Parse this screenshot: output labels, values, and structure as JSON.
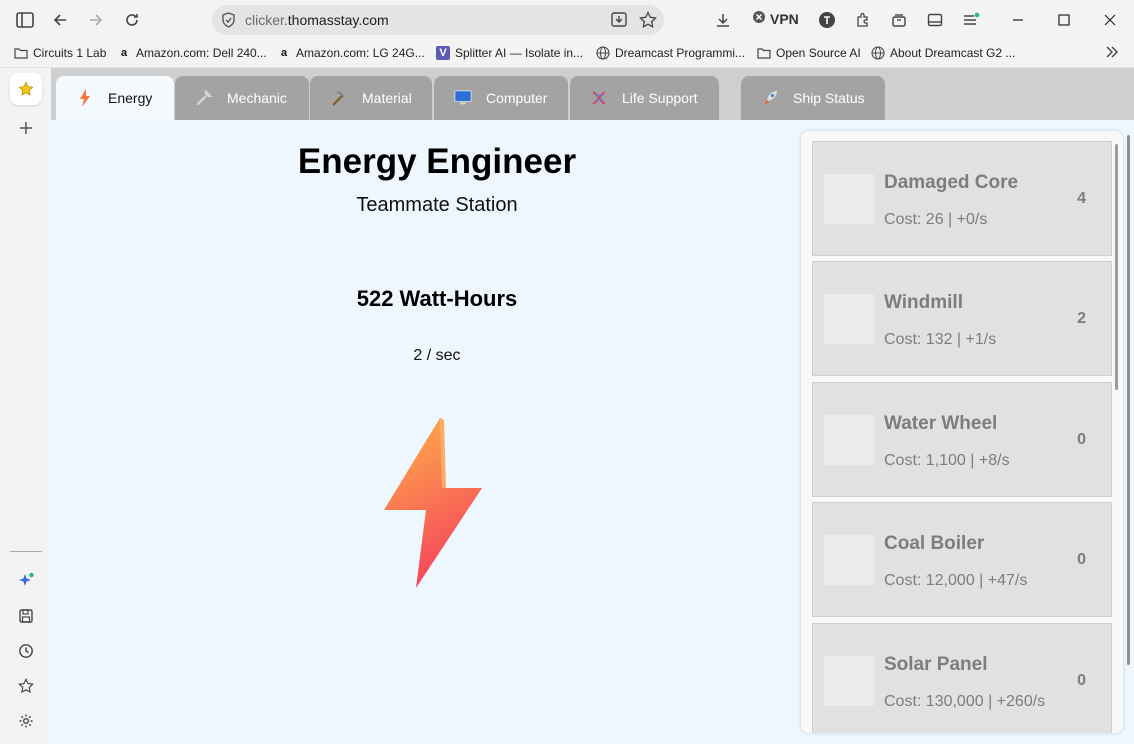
{
  "browser": {
    "url_host_prefix": "clicker.",
    "url_host_main": "thomasstay.com",
    "vpn_label": "VPN",
    "bookmarks": [
      {
        "label": "Circuits 1 Lab",
        "icon": "folder-icon"
      },
      {
        "label": "Amazon.com: Dell 240...",
        "icon": "amazon-icon"
      },
      {
        "label": "Amazon.com: LG 24G...",
        "icon": "amazon-icon"
      },
      {
        "label": "Splitter AI — Isolate in...",
        "icon": "splitter-icon"
      },
      {
        "label": "Dreamcast Programmi...",
        "icon": "globe-icon"
      },
      {
        "label": "Open Source AI",
        "icon": "folder-icon"
      },
      {
        "label": "About Dreamcast G2 ...",
        "icon": "globe-icon"
      }
    ]
  },
  "tabs": [
    {
      "label": "Energy",
      "icon": "lightning-icon",
      "active": true
    },
    {
      "label": "Mechanic",
      "icon": "wrench-icon",
      "active": false
    },
    {
      "label": "Material",
      "icon": "pickaxe-icon",
      "active": false
    },
    {
      "label": "Computer",
      "icon": "computer-icon",
      "active": false
    },
    {
      "label": "Life Support",
      "icon": "dna-icon",
      "active": false
    },
    {
      "label": "Ship Status",
      "icon": "rocket-icon",
      "active": false
    }
  ],
  "main": {
    "title": "Energy Engineer",
    "subtitle": "Teammate Station",
    "resource": "522 Watt-Hours",
    "rate": "2 / sec"
  },
  "upgrades": [
    {
      "name": "Damaged Core",
      "cost": "Cost: 26 | +0/s",
      "count": "4"
    },
    {
      "name": "Windmill",
      "cost": "Cost: 132 | +1/s",
      "count": "2"
    },
    {
      "name": "Water Wheel",
      "cost": "Cost: 1,100 | +8/s",
      "count": "0"
    },
    {
      "name": "Coal Boiler",
      "cost": "Cost: 12,000 | +47/s",
      "count": "0"
    },
    {
      "name": "Solar Panel",
      "cost": "Cost: 130,000 | +260/s",
      "count": "0"
    }
  ],
  "colors": {
    "page_bg": "#eef7fd",
    "tab_inactive": "#a3a3a3",
    "upgrade_bg": "#e1e1e1",
    "bolt_top": "#ffb347",
    "bolt_bottom": "#f5475c"
  }
}
